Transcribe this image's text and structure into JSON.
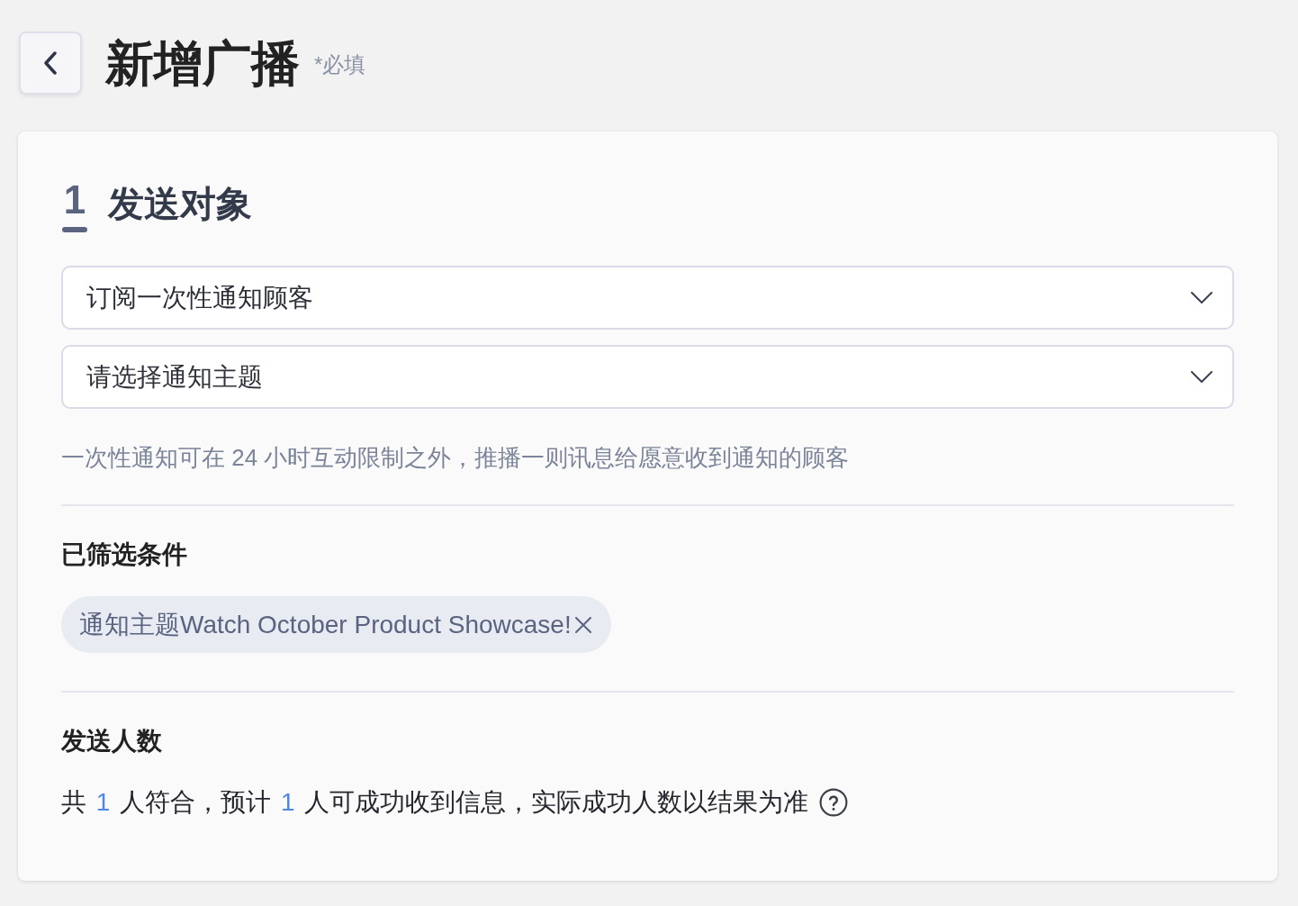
{
  "header": {
    "title": "新增广播",
    "required_note": "*必填"
  },
  "step": {
    "number": "1",
    "title": "发送对象"
  },
  "selects": [
    {
      "value": "订阅一次性通知顾客"
    },
    {
      "placeholder": "请选择通知主题"
    }
  ],
  "hint": "一次性通知可在 24 小时互动限制之外，推播一则讯息给愿意收到通知的顾客",
  "filters": {
    "title": "已筛选条件",
    "tags": [
      {
        "label": "通知主题Watch October Product Showcase!"
      }
    ]
  },
  "recipients": {
    "title": "发送人数",
    "summary": [
      {
        "kind": "text",
        "text": "共 "
      },
      {
        "kind": "count",
        "text": "1"
      },
      {
        "kind": "text",
        "text": " 人符合，预计 "
      },
      {
        "kind": "count",
        "text": "1"
      },
      {
        "kind": "text",
        "text": " 人可成功收到信息，实际成功人数以结果为准"
      }
    ]
  }
}
